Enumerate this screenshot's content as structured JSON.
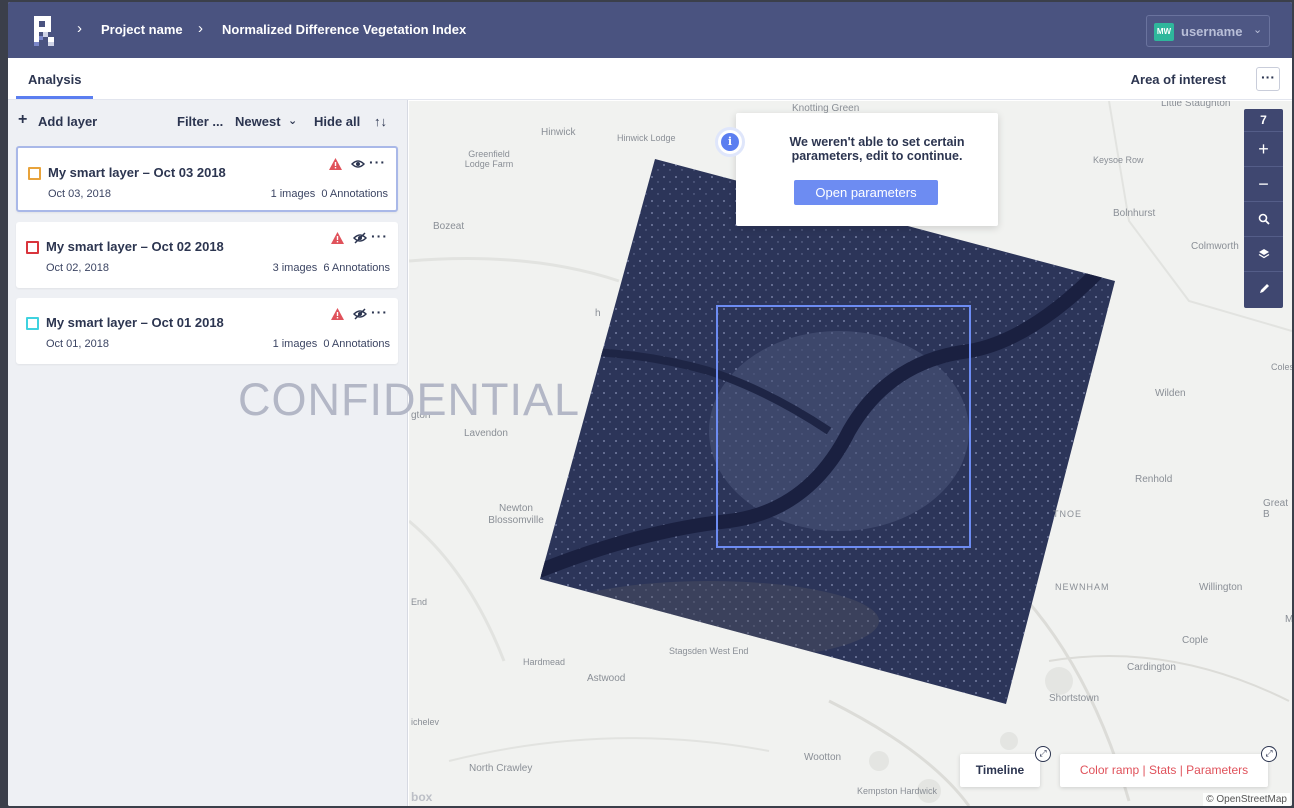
{
  "header": {
    "breadcrumb": [
      "Project name",
      "Normalized Difference Vegetation Index"
    ],
    "user": {
      "initials": "MW",
      "name": "username"
    }
  },
  "tabs": {
    "active": "Analysis",
    "area_of_interest": "Area of interest",
    "more": "···"
  },
  "sidebar": {
    "add_layer": "Add layer",
    "filter": "Filter ...",
    "sort": "Newest",
    "hide_all": "Hide all",
    "sort_arrows": "↑↓",
    "layers": [
      {
        "title": "My smart layer – Oct 03 2018",
        "date": "Oct 03, 2018",
        "images": "1 images",
        "annotations": "0 Annotations",
        "color": "#e8a33b",
        "visible": true
      },
      {
        "title": "My smart layer – Oct 02 2018",
        "date": "Oct 02, 2018",
        "images": "3 images",
        "annotations": "6 Annotations",
        "color": "#d9343c",
        "visible": false
      },
      {
        "title": "My smart layer – Oct 01 2018",
        "date": "Oct 01, 2018",
        "images": "1 images",
        "annotations": "0 Annotations",
        "color": "#3fd2df",
        "visible": false
      }
    ]
  },
  "watermark": "CONFIDENTIAL",
  "toast": {
    "message": "We weren't able to set certain parameters, edit to continue.",
    "button": "Open parameters"
  },
  "zoom": {
    "level": "7",
    "in": "+",
    "out": "−"
  },
  "bottom": {
    "timeline": "Timeline",
    "color_ramp": "Color ramp",
    "stats": "Stats",
    "parameters": "Parameters",
    "separator": "|"
  },
  "attribution": "© OpenStreetMap",
  "mapbox": "box",
  "places": [
    "Knotting Green",
    "Little Staughton",
    "Hinwick",
    "Hinwick Lodge",
    "Greenfield Lodge Farm",
    "Keysoe Row",
    "Bolnhurst",
    "Colmworth",
    "Bozeat",
    "Coles",
    "Wilden",
    "Lavendon",
    "Renhold",
    "Great B",
    "Newton Blossomville",
    "TNOE",
    "NEWNHAM",
    "Willington",
    "End",
    "Cople",
    "Hardmead",
    "Stagsden West End",
    "Cardington",
    "Astwood",
    "Shortstown",
    "ichelev",
    "Wootton",
    "North Crawley",
    "Kempston Hardwick",
    "M",
    "h",
    "gton"
  ],
  "colors": {
    "header": "#4a5380",
    "accent": "#5b7ef0",
    "warning": "#e0525b"
  }
}
